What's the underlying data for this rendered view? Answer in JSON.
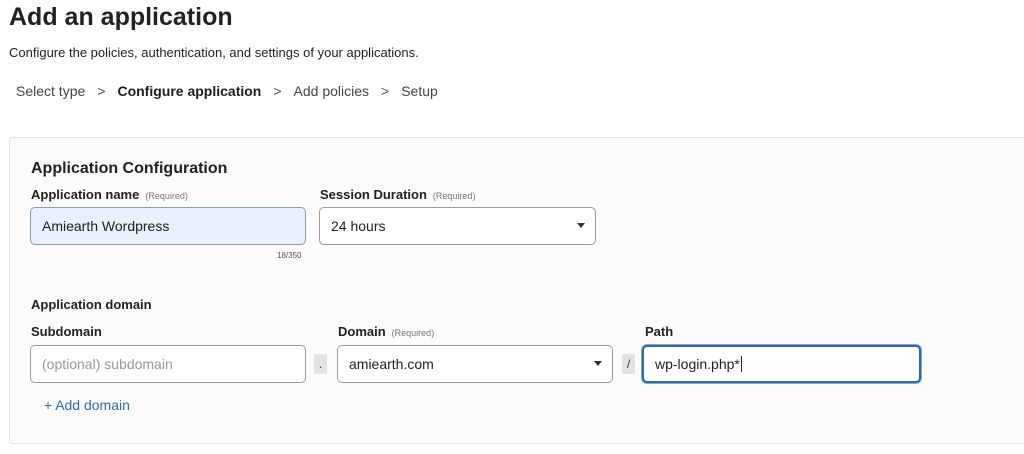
{
  "page": {
    "title": "Add an application",
    "subtitle": "Configure the policies, authentication, and settings of your applications."
  },
  "breadcrumb": {
    "steps": [
      "Select type",
      "Configure application",
      "Add policies",
      "Setup"
    ],
    "active_index": 1,
    "separator": ">"
  },
  "config": {
    "section_title": "Application Configuration",
    "app_name": {
      "label": "Application name",
      "required": "(Required)",
      "value": "Amiearth Wordpress",
      "counter": "18/350"
    },
    "session_duration": {
      "label": "Session Duration",
      "required": "(Required)",
      "value": "24 hours"
    }
  },
  "domain": {
    "section_title": "Application domain",
    "subdomain": {
      "label": "Subdomain",
      "placeholder": "(optional) subdomain"
    },
    "domain": {
      "label": "Domain",
      "required": "(Required)",
      "value": "amiearth.com"
    },
    "path": {
      "label": "Path",
      "value": "wp-login.php*"
    },
    "dot_joiner": ".",
    "slash_joiner": "/",
    "add_domain_label": "Add domain",
    "add_domain_icon": "plus-icon"
  },
  "colors": {
    "link": "#2f6fb8",
    "focus_border": "#2b6cb0",
    "filled_input_bg": "#e8effd"
  }
}
